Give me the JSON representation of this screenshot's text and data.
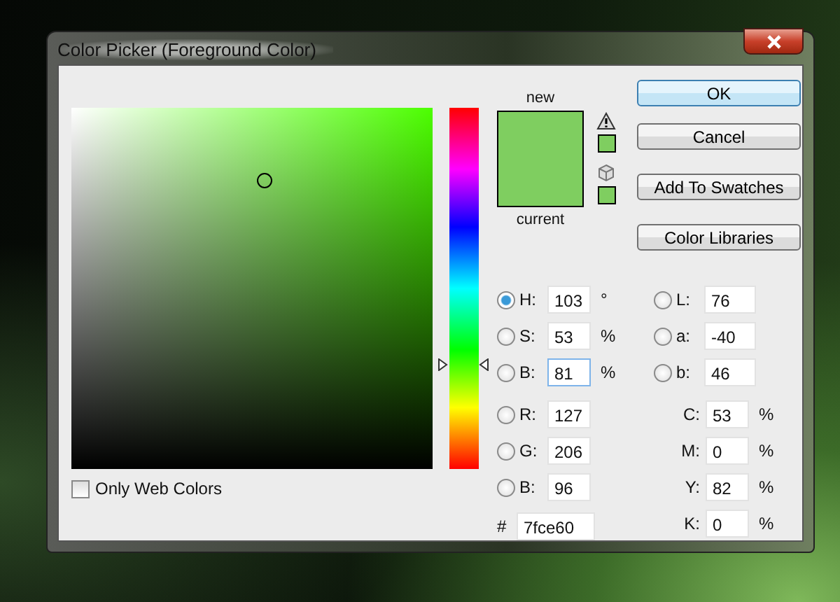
{
  "window": {
    "title": "Color Picker (Foreground Color)"
  },
  "web_colors": {
    "label": "Only Web Colors",
    "checked": false
  },
  "hue_slider": {
    "level": 0.29
  },
  "preview": {
    "new_label": "new",
    "current_label": "current",
    "color": "#7fce60"
  },
  "buttons": [
    {
      "label": "OK",
      "default": true
    },
    {
      "label": "Cancel",
      "default": false
    },
    {
      "label": "Add To Swatches",
      "default": false
    },
    {
      "label": "Color Libraries",
      "default": false
    }
  ],
  "fields_left": [
    {
      "kind": "radio",
      "label": "H:",
      "value": "103",
      "unit": "°",
      "selected": true,
      "focused": false
    },
    {
      "kind": "radio",
      "label": "S:",
      "value": "53",
      "unit": "%",
      "selected": false,
      "focused": false
    },
    {
      "kind": "radio",
      "label": "B:",
      "value": "81",
      "unit": "%",
      "selected": false,
      "focused": true
    },
    {
      "kind": "radio",
      "label": "R:",
      "value": "127",
      "selected": false,
      "focused": false
    },
    {
      "kind": "radio",
      "label": "G:",
      "value": "206",
      "selected": false,
      "focused": false
    },
    {
      "kind": "radio",
      "label": "B:",
      "value": "96",
      "selected": false,
      "focused": false
    },
    {
      "kind": "hex",
      "label": "#",
      "value": "7fce60"
    }
  ],
  "fields_right": [
    {
      "kind": "radio",
      "label": "L:",
      "value": "76",
      "selected": false
    },
    {
      "kind": "radio",
      "label": "a:",
      "value": "-40",
      "selected": false
    },
    {
      "kind": "radio",
      "label": "b:",
      "value": "46",
      "selected": false
    },
    {
      "kind": "plain",
      "label": "C:",
      "value": "53",
      "unit": "%"
    },
    {
      "kind": "plain",
      "label": "M:",
      "value": "0",
      "unit": "%"
    },
    {
      "kind": "plain",
      "label": "Y:",
      "value": "82",
      "unit": "%"
    },
    {
      "kind": "plain",
      "label": "K:",
      "value": "0",
      "unit": "%"
    }
  ]
}
